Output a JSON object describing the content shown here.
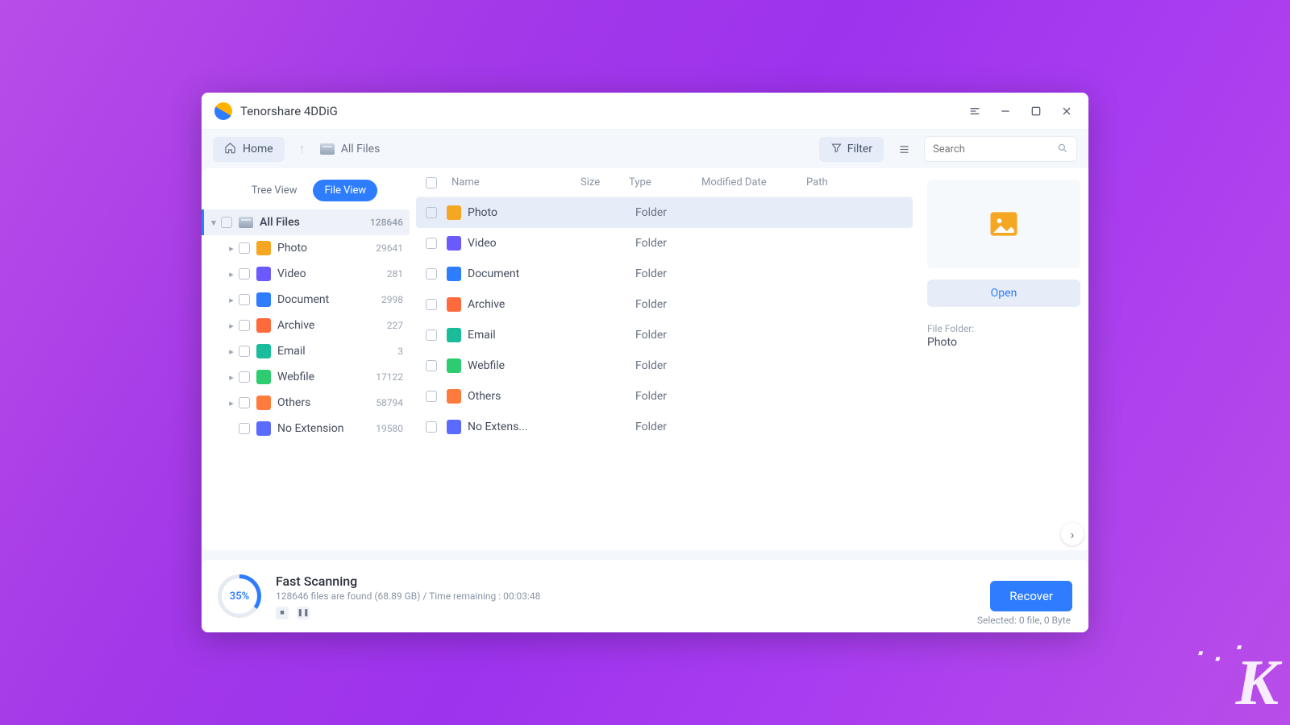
{
  "app": {
    "title": "Tenorshare 4DDiG"
  },
  "toolbar": {
    "home_label": "Home",
    "breadcrumb_label": "All Files",
    "filter_label": "Filter",
    "search_placeholder": "Search"
  },
  "views": {
    "tree": "Tree View",
    "file": "File View",
    "active": "file"
  },
  "tree": {
    "root": {
      "label": "All Files",
      "count": "128646"
    },
    "items": [
      {
        "label": "Photo",
        "count": "29641",
        "color": "#f5a623"
      },
      {
        "label": "Video",
        "count": "281",
        "color": "#6b5bff"
      },
      {
        "label": "Document",
        "count": "2998",
        "color": "#2e7dff"
      },
      {
        "label": "Archive",
        "count": "227",
        "color": "#ff6a3d,#1abc9c"
      },
      {
        "label": "Email",
        "count": "3",
        "color": "#1abc9c"
      },
      {
        "label": "Webfile",
        "count": "17122",
        "color": "#2ecc71"
      },
      {
        "label": "Others",
        "count": "58794",
        "color": "#ff7b3d"
      },
      {
        "label": "No Extension",
        "count": "19580",
        "color": "#5b6bff",
        "leaf": true
      }
    ]
  },
  "columns": {
    "name": "Name",
    "size": "Size",
    "type": "Type",
    "modified": "Modified Date",
    "path": "Path"
  },
  "rows": [
    {
      "name": "Photo",
      "type": "Folder",
      "color": "#f5a623",
      "selected": true
    },
    {
      "name": "Video",
      "type": "Folder",
      "color": "#6b5bff"
    },
    {
      "name": "Document",
      "type": "Folder",
      "color": "#2e7dff"
    },
    {
      "name": "Archive",
      "type": "Folder",
      "color": "#ff6a3d"
    },
    {
      "name": "Email",
      "type": "Folder",
      "color": "#1abc9c"
    },
    {
      "name": "Webfile",
      "type": "Folder",
      "color": "#2ecc71"
    },
    {
      "name": "Others",
      "type": "Folder",
      "color": "#ff7b3d"
    },
    {
      "name": "No Extens...",
      "type": "Folder",
      "color": "#5b6bff"
    }
  ],
  "preview": {
    "open_label": "Open",
    "label": "File Folder:",
    "name": "Photo"
  },
  "scan": {
    "percent": "35%",
    "title": "Fast Scanning",
    "subtext": "128646 files are found (68.89 GB) /   Time remaining : 00:03:48",
    "recover_label": "Recover",
    "selected_text": "Selected: 0 file, 0 Byte"
  }
}
